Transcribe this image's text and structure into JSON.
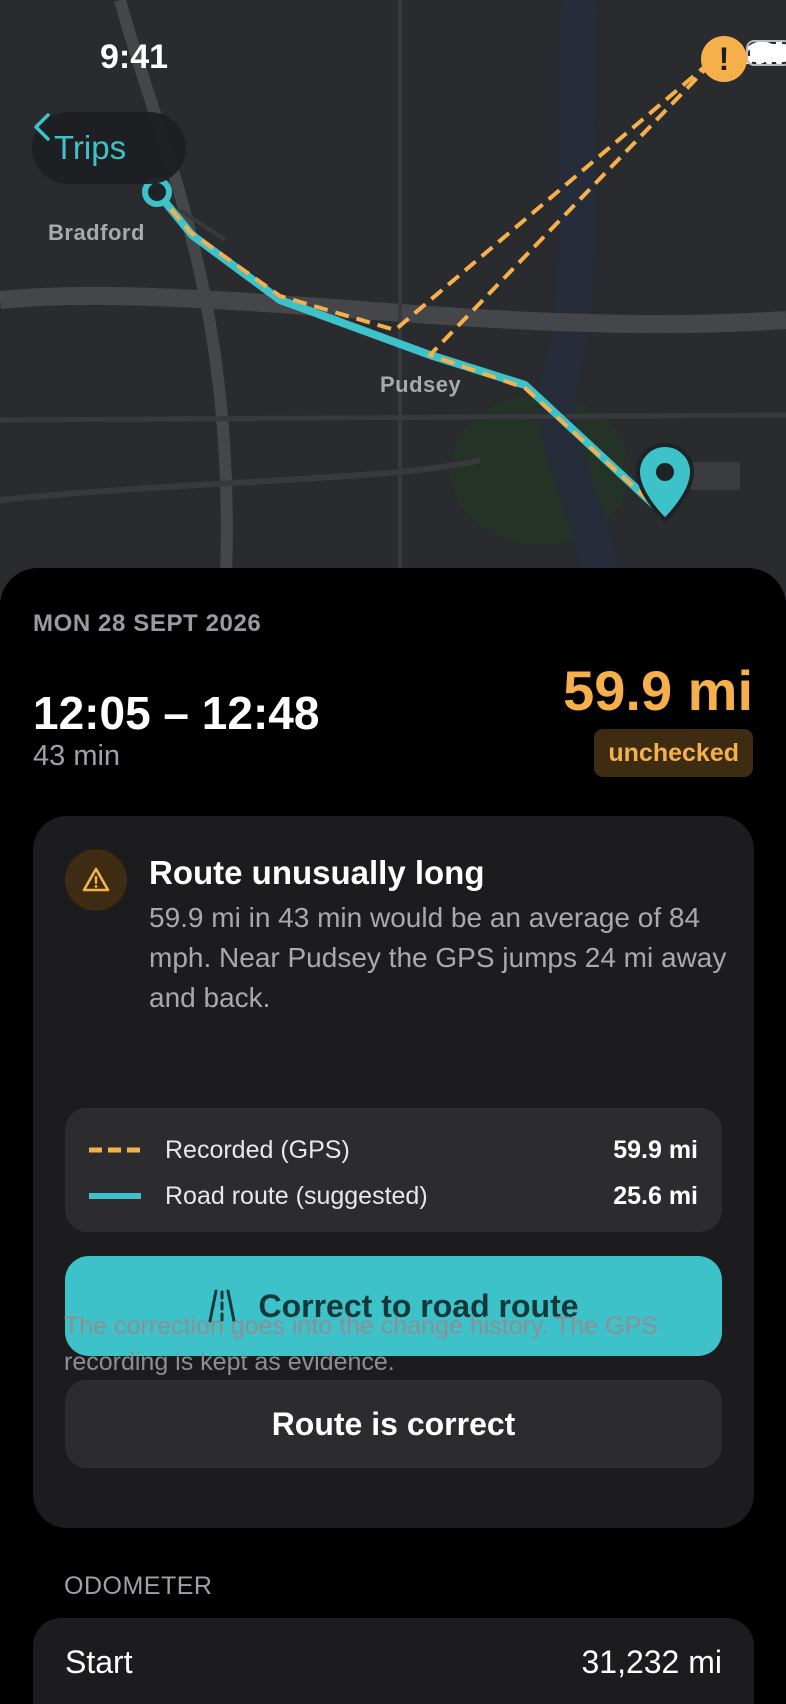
{
  "status_bar": {
    "time": "9:41"
  },
  "nav": {
    "back_label": "Trips"
  },
  "map": {
    "labels": {
      "start_town": "Bradford",
      "mid_town": "Pudsey"
    },
    "colors": {
      "gps": "#f5b04c",
      "road": "#3ec2c9",
      "alert": "#f5b04c"
    }
  },
  "trip": {
    "date": "MON 28 SEPT 2026",
    "time_range": "12:05 – 12:48",
    "duration": "43 min",
    "distance": "59.9 mi",
    "status": "unchecked"
  },
  "alert": {
    "icon": "warning-icon",
    "title": "Route unusually long",
    "text": "59.9 mi in 43 min would be an average of 84 mph. Near Pudsey the GPS jumps 24 mi away and back.",
    "legend": [
      {
        "label": "Recorded (GPS)",
        "value": "59.9 mi"
      },
      {
        "label": "Road route (suggested)",
        "value": "25.6 mi"
      }
    ],
    "primary_button": "Correct to road route",
    "secondary_button": "Route is correct",
    "footnote": "The correction goes into the change history. The GPS recording is kept as evidence."
  },
  "odometer": {
    "section_label": "ODOMETER",
    "start_label": "Start",
    "start_value": "31,232 mi"
  }
}
